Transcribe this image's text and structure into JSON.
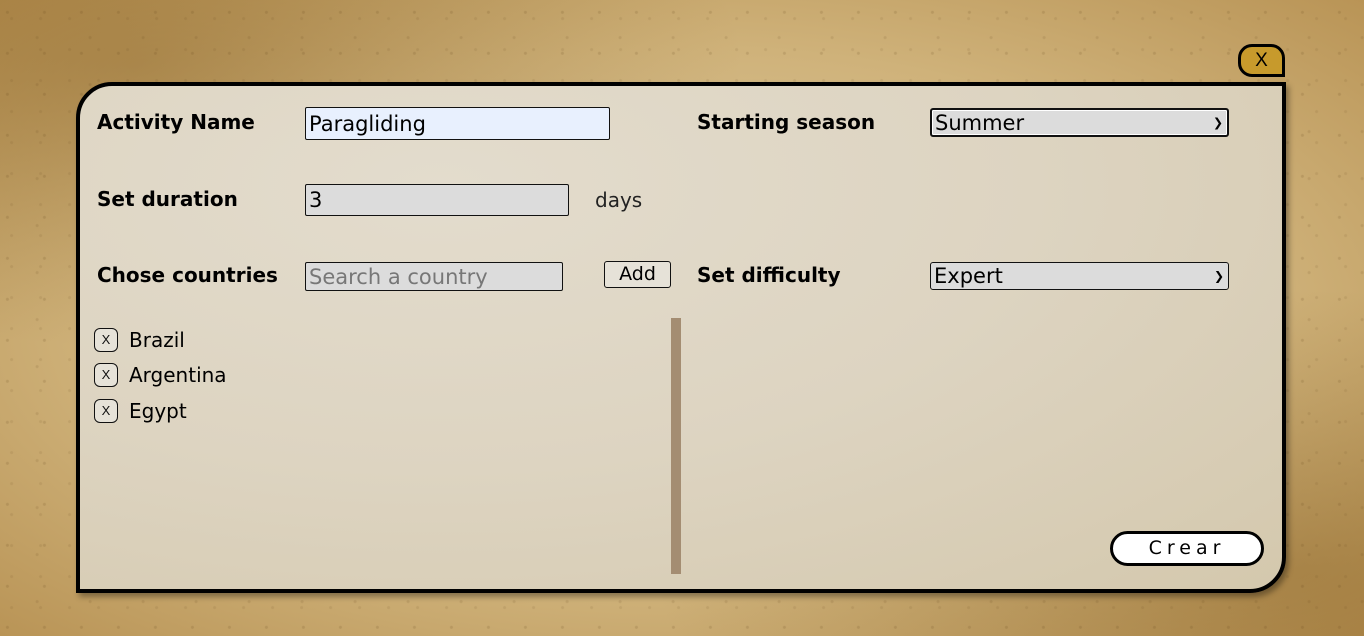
{
  "close_button": {
    "label": "X"
  },
  "form": {
    "activity_name": {
      "label": "Activity Name",
      "value": "Paragliding"
    },
    "starting_season": {
      "label": "Starting season",
      "selected": "Summer"
    },
    "duration": {
      "label": "Set duration",
      "value": "3",
      "unit": "days"
    },
    "countries": {
      "label": "Chose countries",
      "placeholder": "Search a country",
      "add_label": "Add",
      "selected": [
        {
          "remove_label": "X",
          "name": "Brazil"
        },
        {
          "remove_label": "X",
          "name": "Argentina"
        },
        {
          "remove_label": "X",
          "name": "Egypt"
        }
      ]
    },
    "difficulty": {
      "label": "Set difficulty",
      "selected": "Expert"
    },
    "submit_label": "Crear"
  },
  "icons": {
    "select_arrow": "chevron-down-icon"
  }
}
